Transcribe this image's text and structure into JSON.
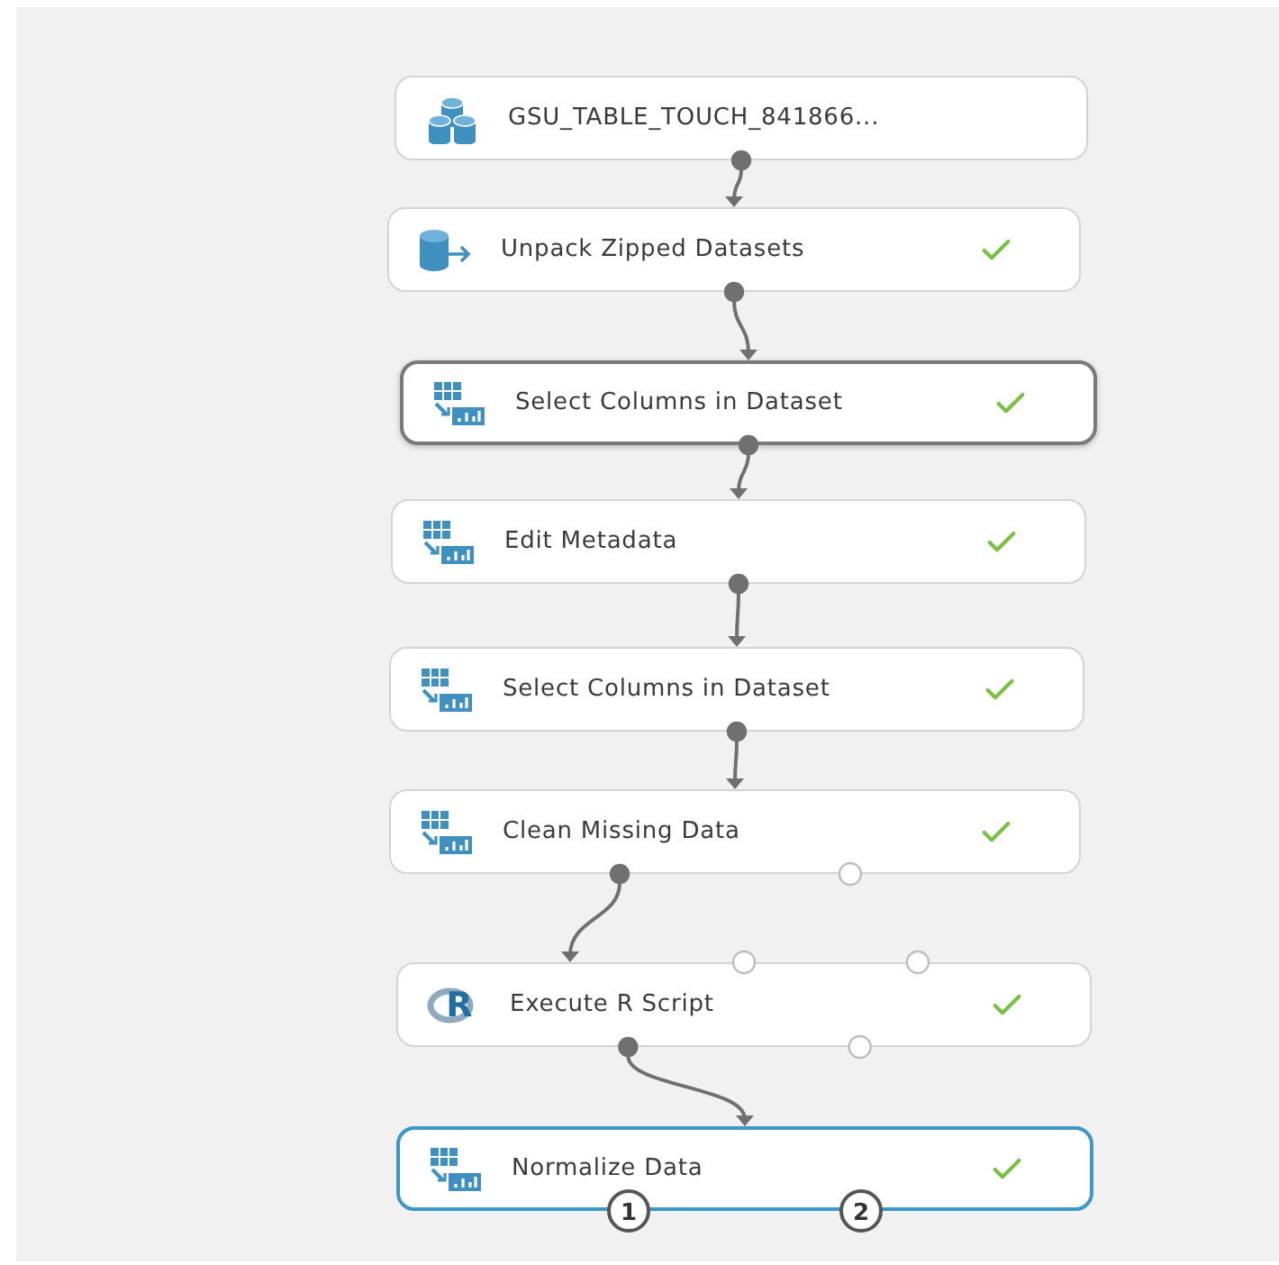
{
  "nodes": [
    {
      "label": "GSU_TABLE_TOUCH_841866...",
      "kind": "dataset",
      "done": false,
      "focused": false,
      "selected": false,
      "outputs": [
        {
          "connected": true
        }
      ]
    },
    {
      "label": "Unpack Zipped Datasets",
      "kind": "unpack",
      "done": true,
      "focused": false,
      "selected": false,
      "inputs": [
        {
          "connected": true
        }
      ],
      "outputs": [
        {
          "connected": true
        }
      ]
    },
    {
      "label": "Select Columns in Dataset",
      "kind": "module",
      "done": true,
      "focused": true,
      "selected": false,
      "inputs": [
        {
          "connected": true
        }
      ],
      "outputs": [
        {
          "connected": true
        }
      ]
    },
    {
      "label": "Edit Metadata",
      "kind": "module",
      "done": true,
      "focused": false,
      "selected": false,
      "inputs": [
        {
          "connected": true
        }
      ],
      "outputs": [
        {
          "connected": true
        }
      ]
    },
    {
      "label": "Select Columns in Dataset",
      "kind": "module",
      "done": true,
      "focused": false,
      "selected": false,
      "inputs": [
        {
          "connected": true
        }
      ],
      "outputs": [
        {
          "connected": true
        }
      ]
    },
    {
      "label": "Clean Missing Data",
      "kind": "module",
      "done": true,
      "focused": false,
      "selected": false,
      "inputs": [
        {
          "connected": true
        }
      ],
      "outputs": [
        {
          "connected": true
        },
        {
          "connected": false
        }
      ]
    },
    {
      "label": "Execute R Script",
      "kind": "r",
      "icon_letter": "R",
      "done": true,
      "focused": false,
      "selected": false,
      "inputs": [
        {
          "connected": true
        },
        {
          "connected": false
        },
        {
          "connected": false
        }
      ],
      "outputs": [
        {
          "connected": true
        },
        {
          "connected": false
        }
      ]
    },
    {
      "label": "Normalize Data",
      "kind": "module",
      "done": true,
      "focused": false,
      "selected": true,
      "inputs": [
        {
          "connected": true
        }
      ],
      "outputs": [
        {
          "connected": false,
          "label": "1"
        },
        {
          "connected": false,
          "label": "2"
        }
      ]
    }
  ]
}
